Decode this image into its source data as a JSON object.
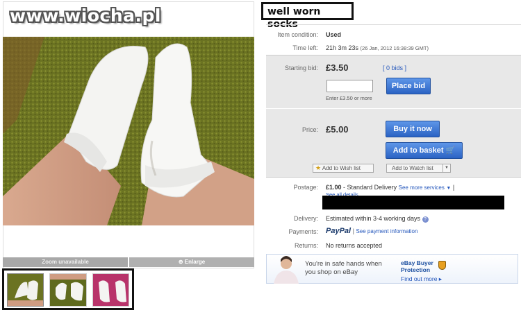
{
  "watermark": "www.wiocha.pl",
  "title": "well worn socks",
  "photo": {
    "zoom_label": "Zoom unavailable",
    "enlarge_label": "Enlarge"
  },
  "details": {
    "condition_label": "Item condition:",
    "condition_value": "Used",
    "timeleft_label": "Time left:",
    "timeleft_value": "21h 3m 23s",
    "timeleft_date": "(26 Jan, 2012 16:38:39 GMT)"
  },
  "bidding": {
    "starting_label": "Starting bid:",
    "starting_value": "£3.50",
    "bids_link": "[ 0 bids ]",
    "place_bid_button": "Place bid",
    "enter_hint": "Enter £3.50 or more",
    "price_label": "Price:",
    "price_value": "£5.00",
    "buy_now_button": "Buy it now",
    "add_basket_button": "Add to basket",
    "wish_list_button": "Add to Wish list",
    "watch_list_button": "Add to Watch list"
  },
  "postage": {
    "label": "Postage:",
    "amount": "£1.00",
    "service": "- Standard Delivery",
    "more_services": "See more services",
    "separator": "|",
    "see_all": "See all details"
  },
  "delivery": {
    "label": "Delivery:",
    "value": "Estimated within 3-4 working days"
  },
  "payments": {
    "label": "Payments:",
    "paypal": "PayPal",
    "separator": "|",
    "info_link": "See payment information"
  },
  "returns": {
    "label": "Returns:",
    "value": "No returns accepted"
  },
  "protection": {
    "safe_line1": "You're in safe hands when",
    "safe_line2": "you shop on eBay",
    "buyer_line1": "eBay Buyer",
    "buyer_line2": "Protection",
    "find_out": "Find out more ▸"
  },
  "colors": {
    "ebay_blue": "#2b63c4",
    "link": "#2255bb",
    "paypal_dark": "#1b3a6b",
    "paypal_light": "#2d8ed8"
  }
}
